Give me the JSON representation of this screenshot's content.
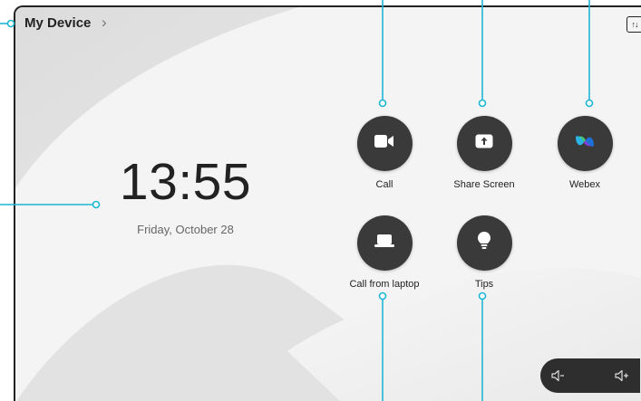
{
  "header": {
    "title": "My Device",
    "chevron_icon": "chevron-right-icon",
    "corner_icon": "sort-arrows-icon"
  },
  "clock": {
    "time": "13:55",
    "date": "Friday, October 28"
  },
  "apps": [
    {
      "id": "call",
      "label": "Call",
      "icon": "video-camera-icon"
    },
    {
      "id": "share-screen",
      "label": "Share Screen",
      "icon": "share-upload-icon"
    },
    {
      "id": "webex",
      "label": "Webex",
      "icon": "webex-logo-icon"
    },
    {
      "id": "call-from-laptop",
      "label": "Call from laptop",
      "icon": "laptop-icon"
    },
    {
      "id": "tips",
      "label": "Tips",
      "icon": "lightbulb-icon"
    }
  ],
  "volume": {
    "down_icon": "volume-down-icon",
    "up_icon": "volume-up-icon"
  },
  "colors": {
    "callout": "#1fb6d4",
    "button": "#3a3a3a",
    "background": "#ececec"
  }
}
